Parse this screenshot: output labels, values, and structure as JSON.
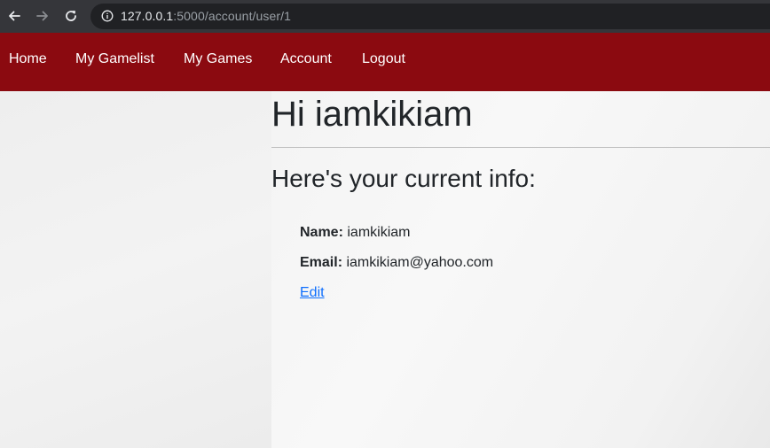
{
  "browser": {
    "url_host": "127.0.0.1",
    "url_rest": ":5000/account/user/1"
  },
  "navbar": {
    "items": [
      {
        "label": "Home"
      },
      {
        "label": "My Gamelist"
      },
      {
        "label": "My Games"
      },
      {
        "label": "Account"
      },
      {
        "label": "Logout"
      }
    ],
    "background": "#8b0a10"
  },
  "main": {
    "greeting": "Hi iamkikiam",
    "subheading": "Here's your current info:",
    "name_label": "Name:",
    "name_value": "iamkikiam",
    "email_label": "Email:",
    "email_value": "iamkikiam@yahoo.com",
    "edit_label": "Edit"
  },
  "colors": {
    "link": "#0d6efd",
    "text": "#212529"
  }
}
